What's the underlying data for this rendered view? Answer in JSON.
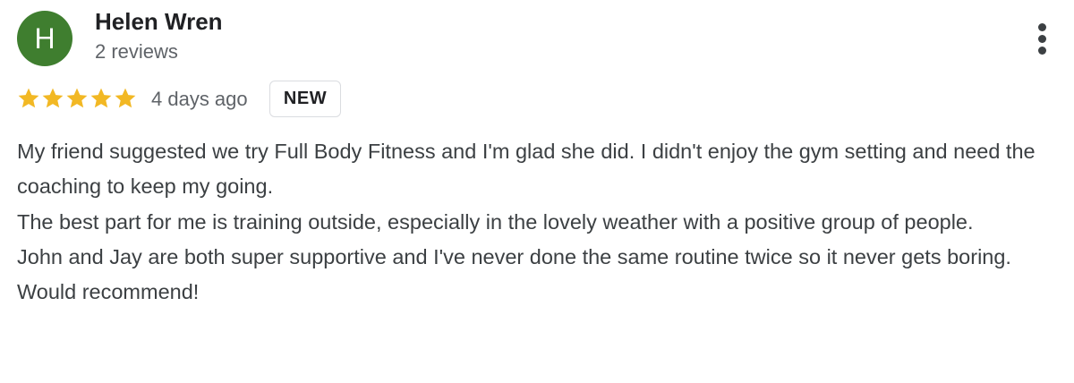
{
  "review": {
    "author": {
      "initial": "H",
      "name": "Helen Wren",
      "review_count": "2 reviews",
      "avatar_color": "#3f7e2f"
    },
    "rating": {
      "stars": 5,
      "max": 5,
      "star_color": "#f2b824"
    },
    "timestamp": "4 days ago",
    "badge": "NEW",
    "more_icon": "more-vert-icon",
    "paragraphs": [
      "My friend suggested we try Full Body Fitness and I'm glad she did. I didn't enjoy the gym setting and need the coaching to keep my going.",
      "The best part for me is training outside, especially in the lovely weather with a positive group of people.",
      "John and Jay are both super supportive and I've never done the same routine twice so it never gets boring.",
      "Would recommend!"
    ]
  }
}
